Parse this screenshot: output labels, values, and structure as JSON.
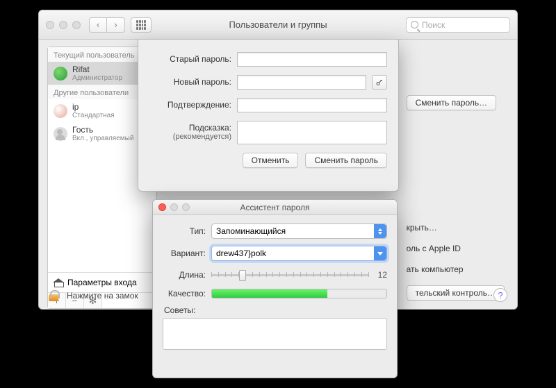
{
  "main": {
    "title": "Пользователи и группы",
    "search_placeholder": "Поиск",
    "sidebar": {
      "current_label": "Текущий пользователь",
      "others_label": "Другие пользователи",
      "users": [
        {
          "name": "Rifat",
          "role": "Администратор"
        },
        {
          "name": "ip",
          "role": "Стандартная"
        },
        {
          "name": "Гость",
          "role": "Вкл., управляемый"
        }
      ],
      "login_options": "Параметры входа",
      "add": "+",
      "remove": "−",
      "gear": "✻"
    },
    "change_password_btn": "Сменить пароль…",
    "action_open": "крыть…",
    "action_appleid": "оль с Apple ID",
    "action_link_computer": "ать компьютер",
    "action_parental": "тельский контроль…",
    "lock_text": "Нажмите на замок",
    "help": "?"
  },
  "sheet": {
    "old": "Старый пароль:",
    "new": "Новый пароль:",
    "confirm": "Подтверждение:",
    "hint_label": "Подсказка:",
    "hint_sub": "(рекомендуется)",
    "cancel": "Отменить",
    "submit": "Сменить пароль"
  },
  "assist": {
    "title": "Ассистент пароля",
    "type_label": "Тип:",
    "type_value": "Запоминающийся",
    "variant_label": "Вариант:",
    "variant_value": "drew437}polk",
    "length_label": "Длина:",
    "length_value": "12",
    "quality_label": "Качество:",
    "tips_label": "Советы:"
  }
}
